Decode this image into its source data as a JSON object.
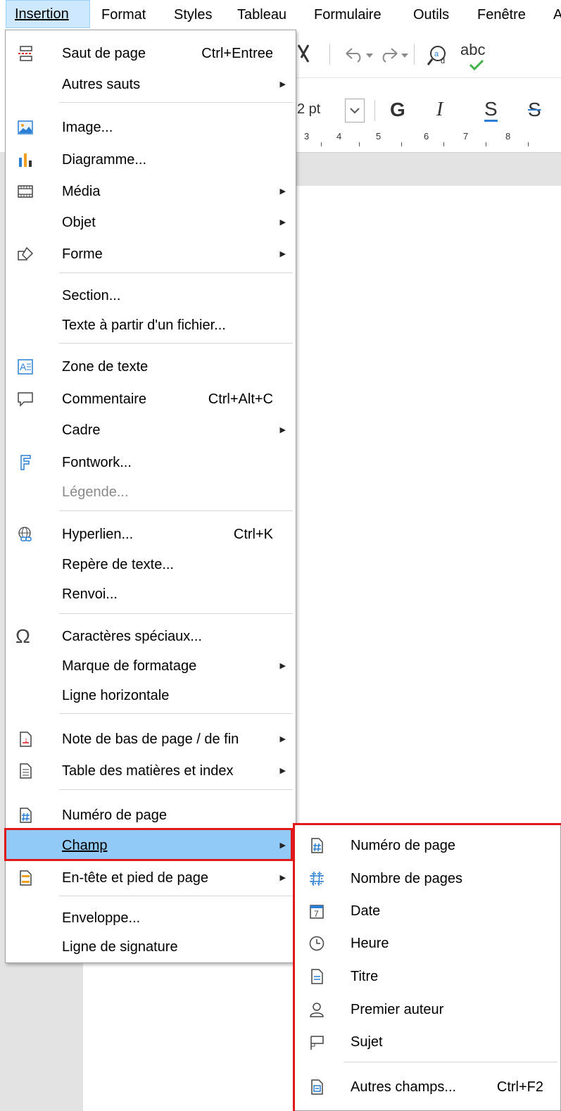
{
  "menubar": {
    "items": [
      "Insertion",
      "Format",
      "Styles",
      "Tableau",
      "Formulaire",
      "Outils",
      "Fenêtre",
      "A"
    ]
  },
  "toolbar": {
    "font_size": "2 pt",
    "bold": "G",
    "italic": "I",
    "underline": "S",
    "strike": "S",
    "spell": "abc"
  },
  "ruler": {
    "ticks": [
      "3",
      "4",
      "5",
      "6",
      "7",
      "8"
    ]
  },
  "insertion_menu": {
    "items": [
      {
        "label": "Saut de page",
        "shortcut": "Ctrl+Entree",
        "icon": "page-break-icon"
      },
      {
        "label": "Autres sauts",
        "submenu": true
      },
      {
        "label": "Image...",
        "icon": "image-icon"
      },
      {
        "label": "Diagramme...",
        "icon": "chart-icon"
      },
      {
        "label": "Média",
        "icon": "media-icon",
        "submenu": true
      },
      {
        "label": "Objet",
        "submenu": true
      },
      {
        "label": "Forme",
        "icon": "shape-icon",
        "submenu": true
      },
      {
        "label": "Section..."
      },
      {
        "label": "Texte à partir d'un fichier..."
      },
      {
        "label": "Zone de texte",
        "icon": "text-box-icon"
      },
      {
        "label": "Commentaire",
        "shortcut": "Ctrl+Alt+C",
        "icon": "comment-icon"
      },
      {
        "label": "Cadre",
        "submenu": true
      },
      {
        "label": "Fontwork...",
        "icon": "fontwork-icon"
      },
      {
        "label": "Légende...",
        "disabled": true
      },
      {
        "label": "Hyperlien...",
        "shortcut": "Ctrl+K",
        "icon": "hyperlink-icon"
      },
      {
        "label": "Repère de texte..."
      },
      {
        "label": "Renvoi..."
      },
      {
        "label": "Caractères spéciaux...",
        "icon": "omega-icon"
      },
      {
        "label": "Marque de formatage",
        "submenu": true
      },
      {
        "label": "Ligne horizontale"
      },
      {
        "label": "Note de bas de page / de fin",
        "icon": "footnote-icon",
        "submenu": true
      },
      {
        "label": "Table des matières et index",
        "icon": "toc-icon",
        "submenu": true
      },
      {
        "label": "Numéro de page",
        "icon": "page-number-icon"
      },
      {
        "label": "Champ",
        "submenu": true,
        "highlighted": true
      },
      {
        "label": "En-tête et pied de page",
        "icon": "header-footer-icon",
        "submenu": true
      },
      {
        "label": "Enveloppe..."
      },
      {
        "label": "Ligne de signature"
      }
    ]
  },
  "champ_submenu": {
    "items": [
      {
        "label": "Numéro de page",
        "icon": "page-number-icon"
      },
      {
        "label": "Nombre de pages",
        "icon": "page-count-icon"
      },
      {
        "label": "Date",
        "icon": "calendar-icon"
      },
      {
        "label": "Heure",
        "icon": "clock-icon"
      },
      {
        "label": "Titre",
        "icon": "document-icon"
      },
      {
        "label": "Premier auteur",
        "icon": "person-icon"
      },
      {
        "label": "Sujet",
        "icon": "flag-icon"
      },
      {
        "label": "Autres champs...",
        "shortcut": "Ctrl+F2",
        "icon": "more-fields-icon"
      }
    ]
  },
  "colors": {
    "highlight": "#91c9f7",
    "annotation_red": "#e0191b",
    "icon_blue": "#2a7fd4"
  }
}
